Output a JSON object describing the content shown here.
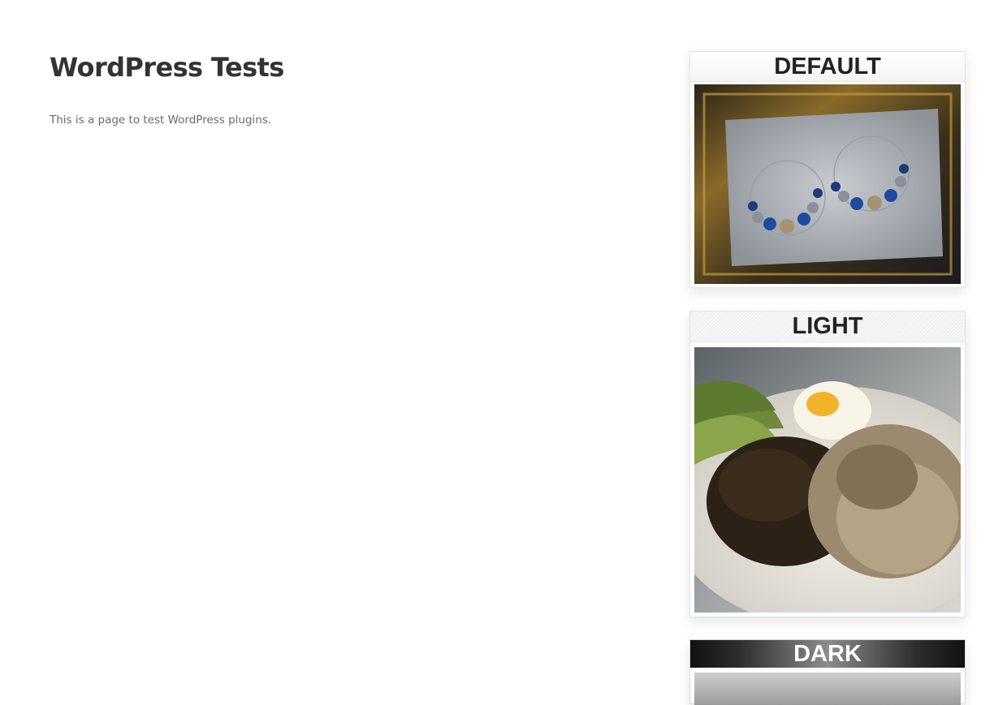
{
  "page": {
    "title": "WordPress Tests",
    "description": "This is a page to test WordPress plugins."
  },
  "sidebar": {
    "widgets": [
      {
        "label": "DEFAULT",
        "photo": "photo-earrings-in-frame"
      },
      {
        "label": "LIGHT",
        "photo": "photo-rice-beans-egg-plate"
      },
      {
        "label": "DARK",
        "photo": "photo-partial"
      }
    ]
  }
}
